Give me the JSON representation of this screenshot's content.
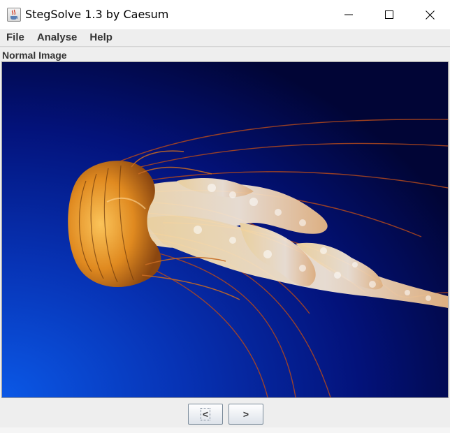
{
  "window": {
    "title": "StegSolve 1.3 by Caesum",
    "icon": "java-coffee-cup-icon"
  },
  "titlebar_controls": {
    "minimize_icon": "minimize-icon",
    "maximize_icon": "maximize-icon",
    "close_icon": "close-icon"
  },
  "menu": {
    "items": [
      {
        "label": "File"
      },
      {
        "label": "Analyse"
      },
      {
        "label": "Help"
      }
    ]
  },
  "viewer": {
    "mode_label": "Normal Image",
    "image_subject": "jellyfish"
  },
  "navigation": {
    "prev_label": "<",
    "next_label": ">"
  },
  "colors": {
    "image_bg_dark": "#020530",
    "image_bg_light": "#0a4fd8",
    "jellyfish_bell": "#e7952b",
    "jellyfish_tentacle": "#f1e2cf",
    "button_border": "#7a8a99"
  }
}
